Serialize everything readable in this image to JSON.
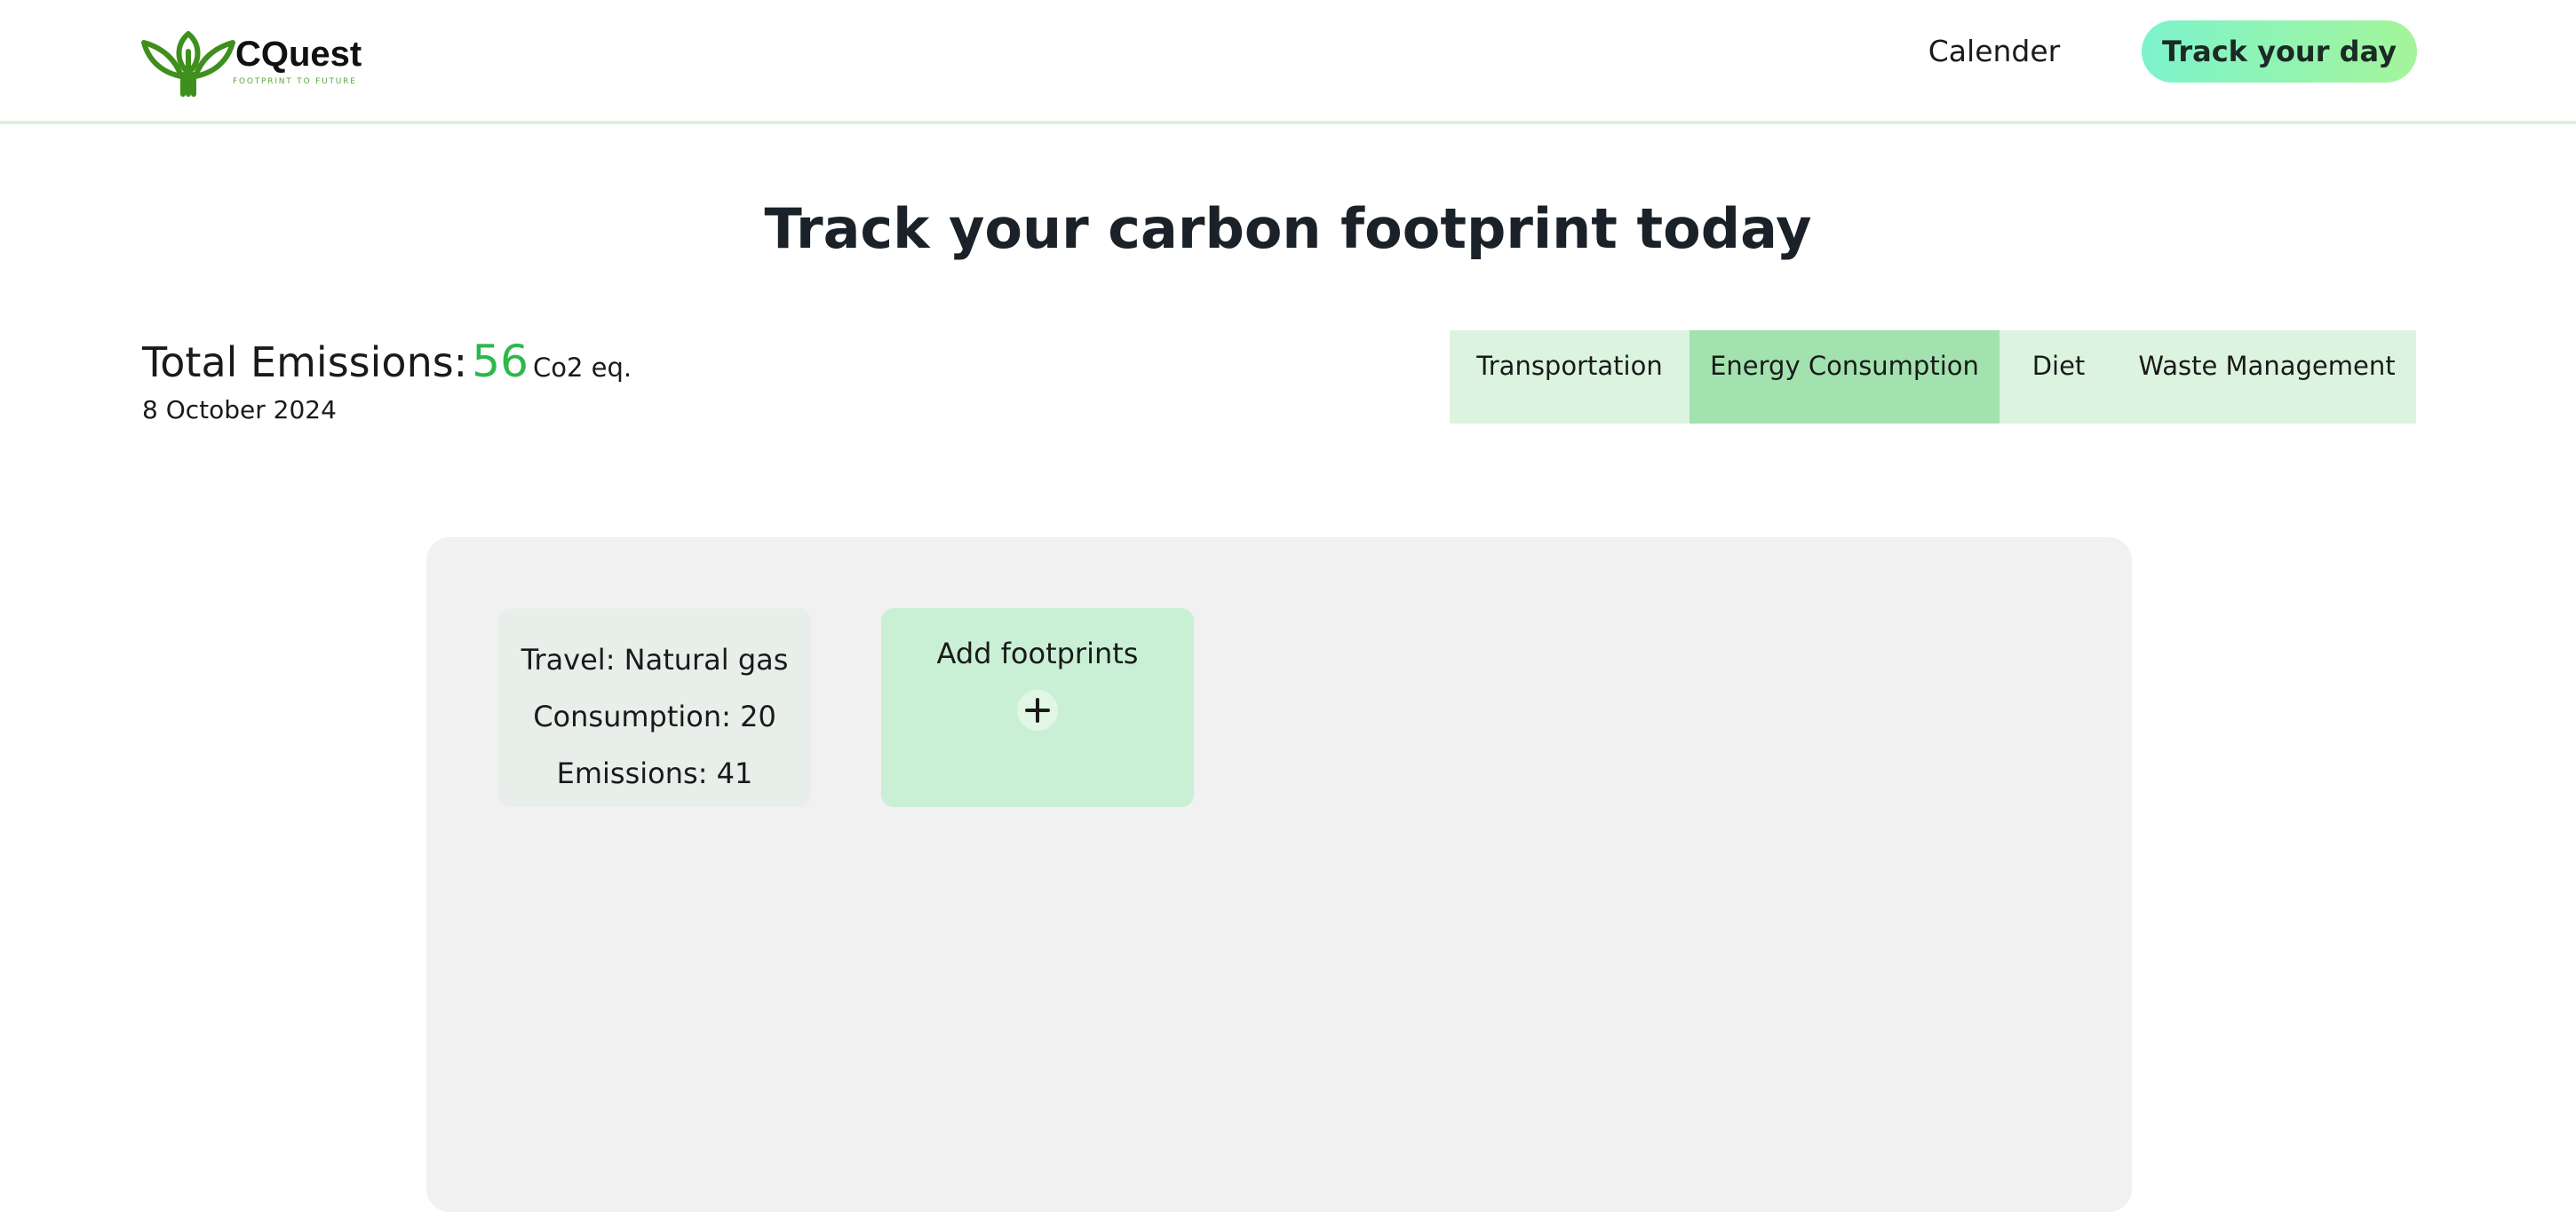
{
  "brand": {
    "name": "CQuest",
    "tagline": "FOOTPRINT TO FUTURE",
    "colors": {
      "leaf": "#3f8f1e",
      "tagline": "#5aa83a"
    }
  },
  "nav": {
    "calendar_label": "Calender",
    "cta_label": "Track your day"
  },
  "page": {
    "title": "Track your carbon footprint today"
  },
  "summary": {
    "label": "Total Emissions:",
    "value": "56",
    "unit": "Co2 eq.",
    "date": "8 October 2024"
  },
  "tabs": [
    {
      "label": "Transportation",
      "active": false
    },
    {
      "label": "Energy Consumption",
      "active": true
    },
    {
      "label": "Diet",
      "active": false
    },
    {
      "label": "Waste Management",
      "active": false
    }
  ],
  "entries": [
    {
      "travel": "Travel: Natural gas",
      "consumption": "Consumption: 20",
      "emissions": "Emissions: 41"
    }
  ],
  "add_card": {
    "label": "Add footprints",
    "icon": "plus-icon"
  },
  "colors": {
    "accent_green": "#2db84a",
    "tab_bg": "#dcf4df",
    "tab_active_bg": "#a1e2ae",
    "panel_bg": "#f1f1f1",
    "cta_gradient_start": "#7df3cc",
    "cta_gradient_end": "#a4f59a"
  }
}
